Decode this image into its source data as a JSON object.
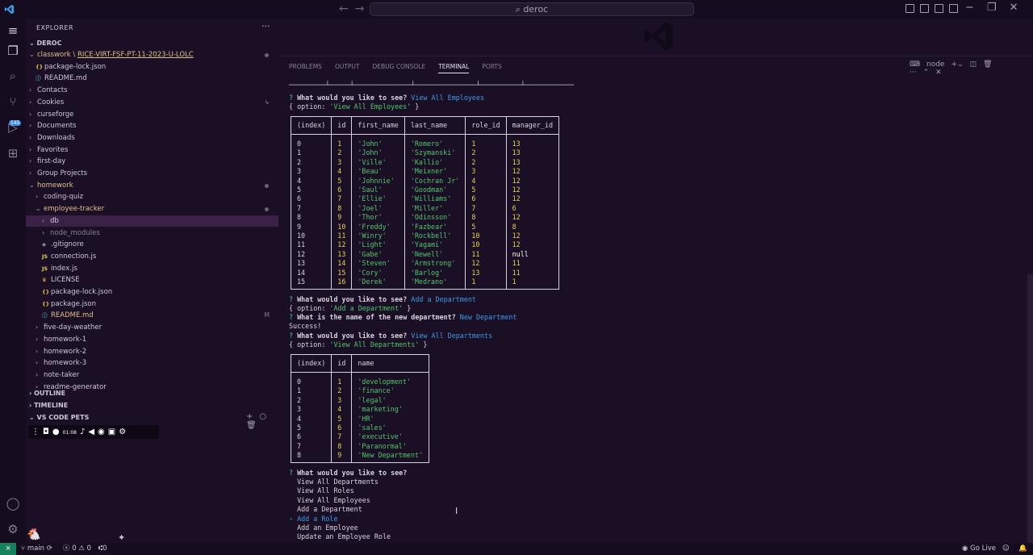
{
  "titlebar": {
    "search": "deroc"
  },
  "sidebar": {
    "title": "EXPLORER",
    "root": "DEROC",
    "tree": [
      {
        "indent": 1,
        "chev": "v",
        "label": "classwork \\ ",
        "label2": "RICE-VIRT-FSF-PT-11-2023-U-LOLC",
        "cls": "yellow",
        "dot": true
      },
      {
        "indent": 2,
        "icon": "{}",
        "iconcls": "json",
        "label": "package-lock.json",
        "cls": ""
      },
      {
        "indent": 2,
        "icon": "ⓘ",
        "iconcls": "md",
        "label": "README.md",
        "cls": ""
      },
      {
        "indent": 1,
        "chev": ">",
        "label": "Contacts",
        "cls": ""
      },
      {
        "indent": 1,
        "chev": ">",
        "label": "Cookies",
        "cls": "",
        "badge": "↳"
      },
      {
        "indent": 1,
        "chev": ">",
        "label": "curseforge",
        "cls": ""
      },
      {
        "indent": 1,
        "chev": ">",
        "label": "Documents",
        "cls": ""
      },
      {
        "indent": 1,
        "chev": ">",
        "label": "Downloads",
        "cls": ""
      },
      {
        "indent": 1,
        "chev": ">",
        "label": "Favorites",
        "cls": ""
      },
      {
        "indent": 1,
        "chev": ">",
        "label": "first-day",
        "cls": ""
      },
      {
        "indent": 1,
        "chev": ">",
        "label": "Group Projects",
        "cls": ""
      },
      {
        "indent": 1,
        "chev": "v",
        "label": "homework",
        "cls": "yellow",
        "dot": true
      },
      {
        "indent": 2,
        "chev": ">",
        "label": "coding-quiz",
        "cls": ""
      },
      {
        "indent": 2,
        "chev": "v",
        "label": "employee-tracker",
        "cls": "yellow",
        "dot": true
      },
      {
        "indent": 3,
        "chev": ">",
        "label": "db",
        "cls": "",
        "selected": true
      },
      {
        "indent": 3,
        "chev": ">",
        "label": "node_modules",
        "cls": "dim"
      },
      {
        "indent": 3,
        "icon": "◆",
        "iconcls": "git",
        "label": ".gitignore",
        "cls": ""
      },
      {
        "indent": 3,
        "icon": "JS",
        "iconcls": "js",
        "label": "connection.js",
        "cls": ""
      },
      {
        "indent": 3,
        "icon": "JS",
        "iconcls": "js",
        "label": "index.js",
        "cls": ""
      },
      {
        "indent": 3,
        "icon": "♛",
        "iconcls": "lic",
        "label": "LICENSE",
        "cls": ""
      },
      {
        "indent": 3,
        "icon": "{}",
        "iconcls": "json",
        "label": "package-lock.json",
        "cls": ""
      },
      {
        "indent": 3,
        "icon": "{}",
        "iconcls": "json",
        "label": "package.json",
        "cls": ""
      },
      {
        "indent": 3,
        "icon": "ⓘ",
        "iconcls": "md",
        "label": "README.md",
        "cls": "yellow",
        "badge": "M"
      },
      {
        "indent": 2,
        "chev": ">",
        "label": "five-day-weather",
        "cls": ""
      },
      {
        "indent": 2,
        "chev": ">",
        "label": "homework-1",
        "cls": ""
      },
      {
        "indent": 2,
        "chev": ">",
        "label": "homework-2",
        "cls": ""
      },
      {
        "indent": 2,
        "chev": ">",
        "label": "homework-3",
        "cls": ""
      },
      {
        "indent": 2,
        "chev": ">",
        "label": "note-taker",
        "cls": ""
      },
      {
        "indent": 2,
        "chev": ">",
        "label": "readme-generator",
        "cls": ""
      }
    ],
    "outline": "OUTLINE",
    "timeline": "TIMELINE",
    "pets": "VS CODE PETS",
    "pets_timer": "01:08"
  },
  "panel": {
    "tabs": [
      "PROBLEMS",
      "OUTPUT",
      "DEBUG CONSOLE",
      "TERMINAL",
      "PORTS"
    ],
    "active_tab": "TERMINAL",
    "shell": "node"
  },
  "terminal": {
    "prompt1": "What would you like to see?",
    "answer1": "View All Employees",
    "option1": "'View All Employees'",
    "employees_headers": [
      "(index)",
      "id",
      "first_name",
      "last_name",
      "role_id",
      "manager_id"
    ],
    "employees": [
      [
        "0",
        "1",
        "'John'",
        "'Romero'",
        "1",
        "13"
      ],
      [
        "1",
        "2",
        "'John'",
        "'Szymanski'",
        "2",
        "13"
      ],
      [
        "2",
        "3",
        "'Ville'",
        "'Kallio'",
        "2",
        "13"
      ],
      [
        "3",
        "4",
        "'Beau'",
        "'Meixner'",
        "3",
        "12"
      ],
      [
        "4",
        "5",
        "'Johnnie'",
        "'Cochran Jr'",
        "4",
        "12"
      ],
      [
        "5",
        "6",
        "'Saul'",
        "'Goodman'",
        "5",
        "12"
      ],
      [
        "6",
        "7",
        "'Ellie'",
        "'Williams'",
        "6",
        "12"
      ],
      [
        "7",
        "8",
        "'Joel'",
        "'Miller'",
        "7",
        "6"
      ],
      [
        "8",
        "9",
        "'Thor'",
        "'Odinsson'",
        "8",
        "12"
      ],
      [
        "9",
        "10",
        "'Freddy'",
        "'Fazbear'",
        "5",
        "8"
      ],
      [
        "10",
        "11",
        "'Winry'",
        "'Rockbell'",
        "10",
        "12"
      ],
      [
        "11",
        "12",
        "'Light'",
        "'Yagami'",
        "10",
        "12"
      ],
      [
        "12",
        "13",
        "'Gabe'",
        "'Newell'",
        "11",
        "null"
      ],
      [
        "13",
        "14",
        "'Steven'",
        "'Armstrong'",
        "12",
        "11"
      ],
      [
        "14",
        "15",
        "'Cory'",
        "'Barlog'",
        "13",
        "11"
      ],
      [
        "15",
        "16",
        "'Derek'",
        "'Medrano'",
        "1",
        "1"
      ]
    ],
    "prompt2": "What would you like to see?",
    "answer2": "Add a Department",
    "option2": "'Add a Department'",
    "prompt3": "What is the name of the new department?",
    "answer3": "New Department",
    "success": "Success!",
    "prompt4": "What would you like to see?",
    "answer4": "View All Departments",
    "option4": "'View All Departments'",
    "departments_headers": [
      "(index)",
      "id",
      "name"
    ],
    "departments": [
      [
        "0",
        "1",
        "'development'"
      ],
      [
        "1",
        "2",
        "'finance'"
      ],
      [
        "2",
        "3",
        "'legal'"
      ],
      [
        "3",
        "4",
        "'marketing'"
      ],
      [
        "4",
        "5",
        "'HR'"
      ],
      [
        "5",
        "6",
        "'sales'"
      ],
      [
        "6",
        "7",
        "'executive'"
      ],
      [
        "7",
        "8",
        "'Paranormal'"
      ],
      [
        "8",
        "9",
        "'New Department'"
      ]
    ],
    "prompt5": "What would you like to see?",
    "menu": [
      "View All Departments",
      "View All Roles",
      "View All Employees",
      "Add a Department",
      "Add a Role",
      "Add an Employee",
      "Update an Employee Role"
    ],
    "menu_selected": 4
  },
  "statusbar": {
    "branch": "main",
    "errors": "0",
    "warnings": "0",
    "ports": "0",
    "golive": "Go Live"
  }
}
